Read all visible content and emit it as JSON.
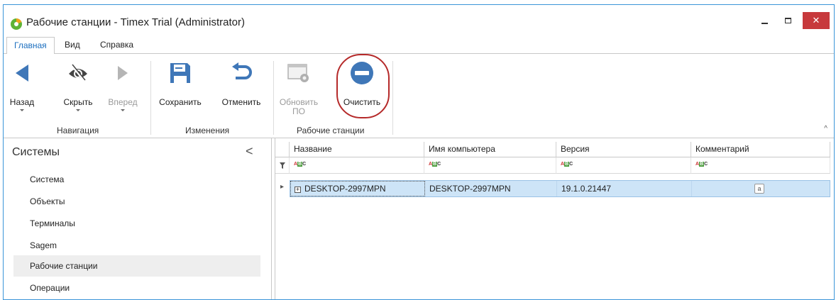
{
  "window": {
    "title": "Рабочие станции - Timex Trial (Administrator)",
    "close_symbol": "✕",
    "accent_color": "#3b95d8",
    "close_color": "#c7393c"
  },
  "menu_tabs": [
    {
      "label": "Главная",
      "active": true
    },
    {
      "label": "Вид",
      "active": false
    },
    {
      "label": "Справка",
      "active": false
    }
  ],
  "ribbon": {
    "groups": [
      {
        "label": "Навигация",
        "buttons": [
          {
            "label": "Назад",
            "icon": "back-arrow-icon",
            "enabled": true,
            "dropdown": true
          },
          {
            "label": "Скрыть",
            "icon": "eye-hide-icon",
            "enabled": true,
            "dropdown": true
          },
          {
            "label": "Вперед",
            "icon": "forward-arrow-icon",
            "enabled": false,
            "dropdown": true
          }
        ]
      },
      {
        "label": "Изменения",
        "buttons": [
          {
            "label": "Сохранить",
            "icon": "save-icon",
            "enabled": true
          },
          {
            "label": "Отменить",
            "icon": "undo-icon",
            "enabled": true
          }
        ]
      },
      {
        "label": "Рабочие станции",
        "buttons": [
          {
            "label": "Обновить",
            "label2": "ПО",
            "icon": "update-software-icon",
            "enabled": false
          },
          {
            "label": "Очистить",
            "icon": "clear-minus-icon",
            "enabled": true,
            "highlighted": true
          }
        ]
      }
    ],
    "collapse_symbol": "^"
  },
  "sidebar": {
    "header": "Системы",
    "collapse_symbol": "<",
    "items": [
      {
        "label": "Система",
        "selected": false
      },
      {
        "label": "Объекты",
        "selected": false
      },
      {
        "label": "Терминалы",
        "selected": false
      },
      {
        "label": "Sagem",
        "selected": false
      },
      {
        "label": "Рабочие станции",
        "selected": true
      },
      {
        "label": "Операции",
        "selected": false
      }
    ]
  },
  "grid": {
    "columns": [
      "Название",
      "Имя компьютера",
      "Версия",
      "Комментарий"
    ],
    "filter_icon": "filter-row-icon",
    "rows": [
      {
        "name": "DESKTOP-2997MPN",
        "computer": "DESKTOP-2997MPN",
        "version": "19.1.0.21447",
        "comment": "",
        "selected": true
      }
    ],
    "row_indicator": "▸",
    "expand_symbol": "+",
    "comment_icon_text": "a"
  }
}
